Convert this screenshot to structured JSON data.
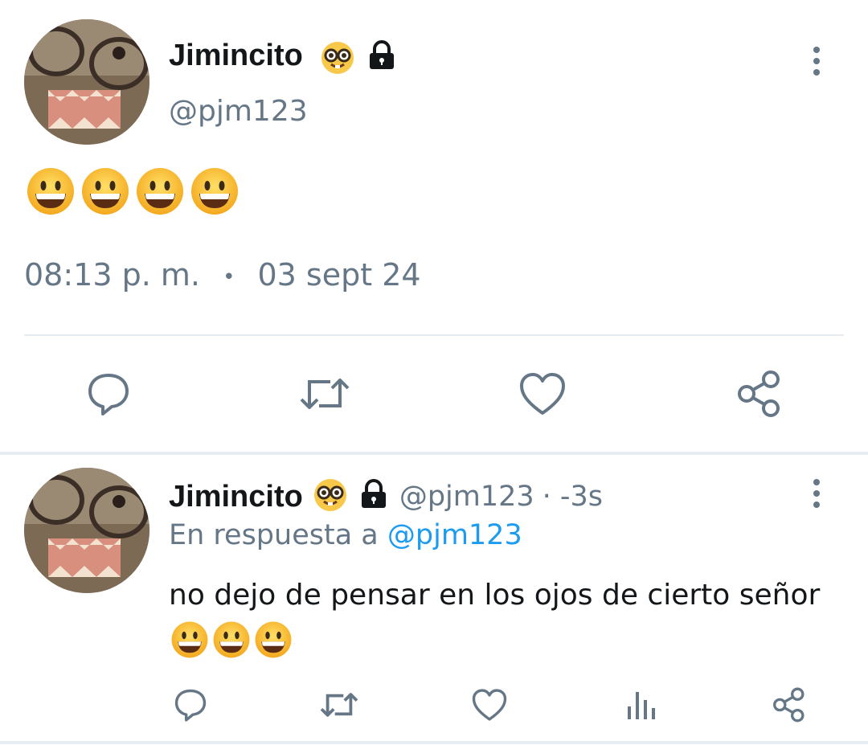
{
  "main_tweet": {
    "display_name": "Jimincito",
    "handle": "@pjm123",
    "name_emoji": "nerd-face-emoji",
    "lock_icon": "lock-icon",
    "content_emojis": [
      "grinning-face-emoji",
      "grinning-face-emoji",
      "grinning-face-emoji",
      "grinning-face-emoji"
    ],
    "time": "08:13 p. m.",
    "separator": "•",
    "date": "03 sept 24",
    "actions": [
      "reply-icon",
      "retweet-icon",
      "like-icon",
      "share-icon"
    ]
  },
  "reply_tweet": {
    "display_name": "Jimincito",
    "handle": "@pjm123",
    "time_suffix": "· -3s",
    "in_reply_prefix": "En respuesta a",
    "in_reply_handle": "@pjm123",
    "text": "no dejo de pensar en los ojos de cierto señor",
    "content_emojis": [
      "grinning-face-emoji",
      "grinning-face-emoji",
      "grinning-face-emoji"
    ],
    "actions": [
      "reply-icon",
      "retweet-icon",
      "like-icon",
      "analytics-icon",
      "share-icon"
    ]
  },
  "colors": {
    "text": "#14171a",
    "muted": "#657786",
    "link": "#1d9bf0",
    "divider": "#e6ecf0"
  }
}
